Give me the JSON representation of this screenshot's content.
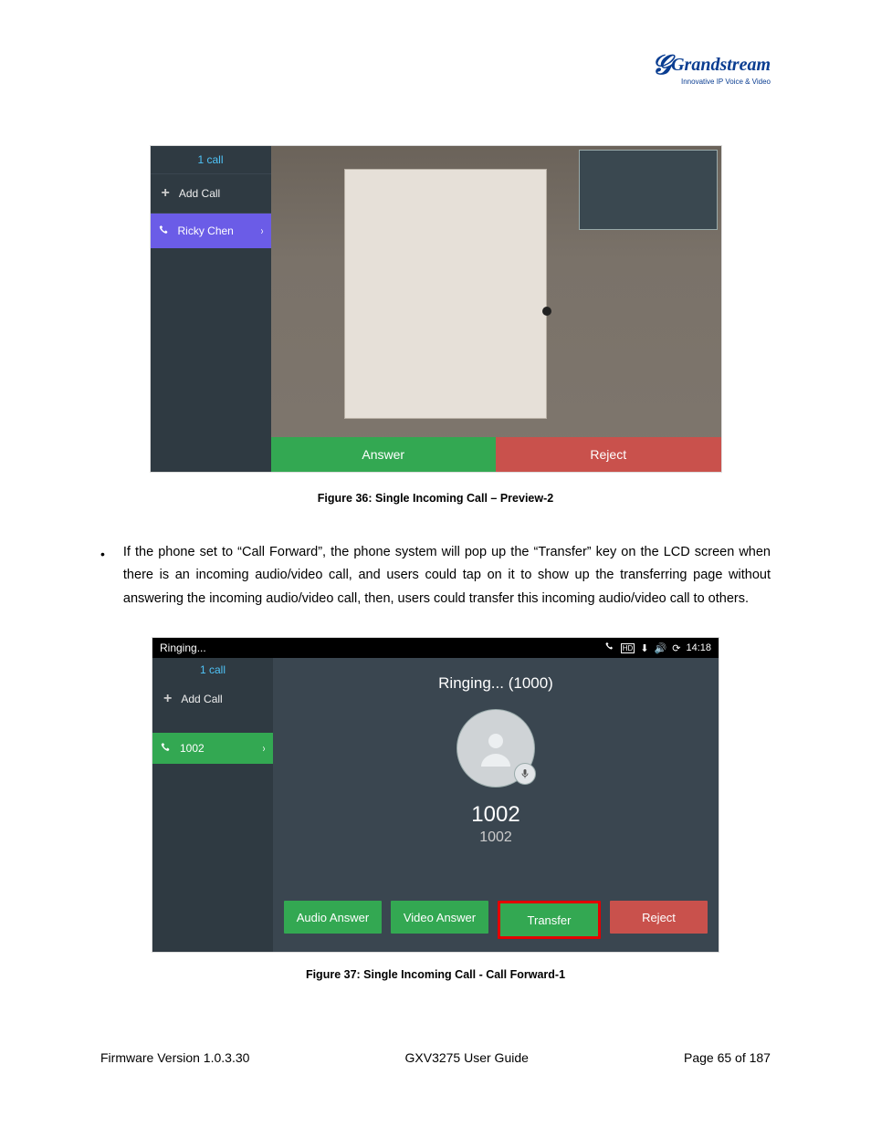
{
  "logo": {
    "brand": "Grandstream",
    "tag": "Innovative IP Voice & Video"
  },
  "fig1": {
    "sidebar": {
      "header": "1 call",
      "add": "Add Call",
      "active_name": "Ricky Chen"
    },
    "buttons": {
      "answer": "Answer",
      "reject": "Reject"
    },
    "caption": "Figure 36: Single Incoming Call – Preview-2"
  },
  "para": {
    "text": "If the phone set to “Call Forward”, the phone system will pop up the “Transfer” key on the LCD screen when there is an incoming audio/video call, and users could tap on it to show up the transferring page without answering the incoming audio/video call, then, users could transfer this incoming audio/video call to others."
  },
  "fig2": {
    "status": {
      "left": "Ringing...",
      "time": "14:18"
    },
    "sidebar": {
      "header": "1 call",
      "add": "Add Call",
      "active": "1002"
    },
    "main": {
      "title": "Ringing... (1000)",
      "num1": "1002",
      "num2": "1002"
    },
    "buttons": {
      "audio": "Audio Answer",
      "video": "Video Answer",
      "transfer": "Transfer",
      "reject": "Reject"
    },
    "caption": "Figure 37: Single Incoming Call - Call Forward-1"
  },
  "footer": {
    "left": "Firmware Version 1.0.3.30",
    "center": "GXV3275 User Guide",
    "right": "Page 65 of 187"
  }
}
